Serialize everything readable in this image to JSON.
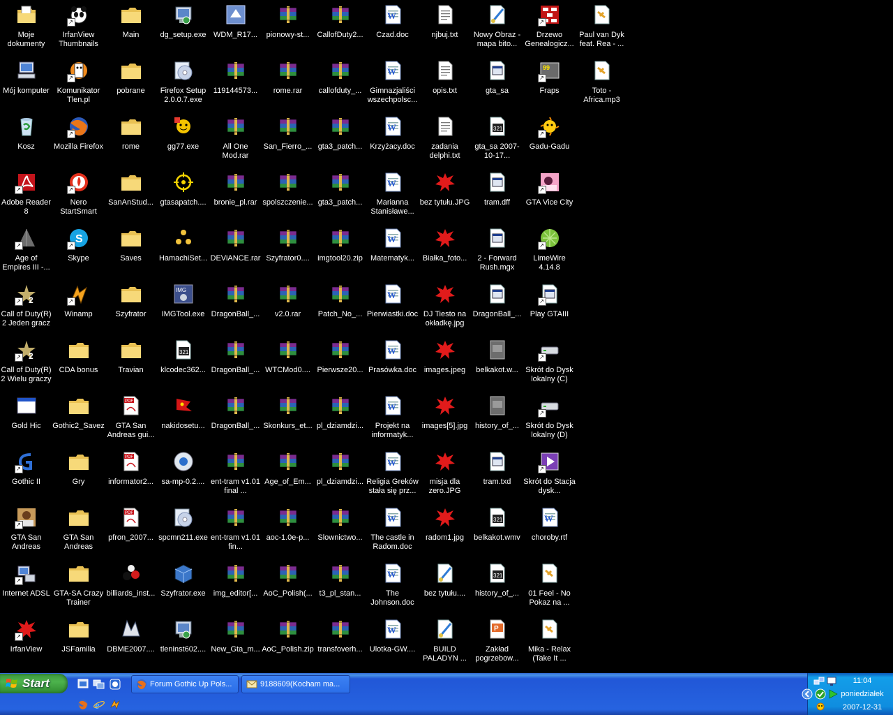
{
  "desktop": {
    "icons": [
      {
        "label": "Moje dokumenty",
        "type": "mydocs",
        "sc": false
      },
      {
        "label": "IrfanView Thumbnails",
        "type": "panda",
        "sc": true
      },
      {
        "label": "Main",
        "type": "folder",
        "sc": false
      },
      {
        "label": "dg_setup.exe",
        "type": "setup",
        "sc": false
      },
      {
        "label": "WDM_R17...",
        "type": "wdm",
        "sc": false
      },
      {
        "label": "pionowy-st...",
        "type": "rar",
        "sc": false
      },
      {
        "label": "CallofDuty2...",
        "type": "rar",
        "sc": false
      },
      {
        "label": "Czad.doc",
        "type": "doc",
        "sc": false
      },
      {
        "label": "njbuj.txt",
        "type": "txt",
        "sc": false
      },
      {
        "label": "Nowy Obraz - mapa bito...",
        "type": "paintfile",
        "sc": false
      },
      {
        "label": "Drzewo Genealogicz...",
        "type": "tree",
        "sc": true
      },
      {
        "label": "Paul van Dyk feat. Rea - ...",
        "type": "mp3",
        "sc": false
      },
      {
        "label": "Mój komputer",
        "type": "mycomp",
        "sc": false
      },
      {
        "label": "Komunikator Tlen.pl",
        "type": "tlen",
        "sc": true
      },
      {
        "label": "pobrane",
        "type": "folder",
        "sc": false
      },
      {
        "label": "Firefox Setup 2.0.0.7.exe",
        "type": "cdsetup",
        "sc": false
      },
      {
        "label": "119144573...",
        "type": "rar",
        "sc": false
      },
      {
        "label": "rome.rar",
        "type": "rar",
        "sc": false
      },
      {
        "label": "callofduty_...",
        "type": "rar",
        "sc": false
      },
      {
        "label": "Gimnazjaliści wszechpolsc...",
        "type": "doc",
        "sc": false
      },
      {
        "label": "opis.txt",
        "type": "txt",
        "sc": false
      },
      {
        "label": "gta_sa",
        "type": "dll",
        "sc": false
      },
      {
        "label": "Fraps",
        "type": "fraps",
        "sc": true
      },
      {
        "label": "Toto - Africa.mp3",
        "type": "mp3",
        "sc": false
      },
      {
        "label": "Kosz",
        "type": "bin",
        "sc": false
      },
      {
        "label": "Mozilla Firefox",
        "type": "firefox",
        "sc": true
      },
      {
        "label": "rome",
        "type": "folder",
        "sc": false
      },
      {
        "label": "gg77.exe",
        "type": "gg",
        "sc": false
      },
      {
        "label": "All One Mod.rar",
        "type": "rar",
        "sc": false
      },
      {
        "label": "San_Fierro_...",
        "type": "rar",
        "sc": false
      },
      {
        "label": "gta3_patch...",
        "type": "rar",
        "sc": false
      },
      {
        "label": "Krzyżacy.doc",
        "type": "doc",
        "sc": false
      },
      {
        "label": "zadania delphi.txt",
        "type": "txt",
        "sc": false
      },
      {
        "label": "gta_sa 2007-10-17...",
        "type": "video",
        "sc": false
      },
      {
        "label": "Gadu-Gadu",
        "type": "gadu",
        "sc": true
      },
      {
        "label": "Adobe Reader 8",
        "type": "adobe",
        "sc": true
      },
      {
        "label": "Nero StartSmart",
        "type": "nero",
        "sc": true
      },
      {
        "label": "SanAnStud...",
        "type": "folder",
        "sc": false
      },
      {
        "label": "gtasapatch....",
        "type": "target",
        "sc": false
      },
      {
        "label": "bronie_pl.rar",
        "type": "rar",
        "sc": false
      },
      {
        "label": "spolszczenie...",
        "type": "rar",
        "sc": false
      },
      {
        "label": "gta3_patch...",
        "type": "rar",
        "sc": false
      },
      {
        "label": "Marianna Stanisławe...",
        "type": "doc",
        "sc": false
      },
      {
        "label": "bez tytułu.JPG",
        "type": "splat",
        "sc": false
      },
      {
        "label": "tram.dff",
        "type": "dll",
        "sc": false
      },
      {
        "label": "GTA Vice City",
        "type": "vice",
        "sc": true
      },
      {
        "label": "Age of Empires III -...",
        "type": "aoe",
        "sc": true
      },
      {
        "label": "Skype",
        "type": "skype",
        "sc": true
      },
      {
        "label": "Saves",
        "type": "folder",
        "sc": false
      },
      {
        "label": "HamachiSet...",
        "type": "hamachi",
        "sc": false
      },
      {
        "label": "DEViANCE.rar",
        "type": "rar",
        "sc": false
      },
      {
        "label": "Szyfrator0....",
        "type": "rar",
        "sc": false
      },
      {
        "label": "imgtool20.zip",
        "type": "rar",
        "sc": false
      },
      {
        "label": "Matematyk...",
        "type": "doc",
        "sc": false
      },
      {
        "label": "Białka_foto...",
        "type": "splat",
        "sc": false
      },
      {
        "label": "2 - Forward Rush.mgx",
        "type": "dll",
        "sc": false
      },
      {
        "label": "LimeWire 4.14.8",
        "type": "lime",
        "sc": true
      },
      {
        "label": "Call of Duty(R) 2 Jeden gracz",
        "type": "cod",
        "sc": true
      },
      {
        "label": "Winamp",
        "type": "winamp",
        "sc": true
      },
      {
        "label": "Szyfrator",
        "type": "folder",
        "sc": false
      },
      {
        "label": "IMGTool.exe",
        "type": "imgtool",
        "sc": false
      },
      {
        "label": "DragonBall_...",
        "type": "rar",
        "sc": false
      },
      {
        "label": "v2.0.rar",
        "type": "rar",
        "sc": false
      },
      {
        "label": "Patch_No_...",
        "type": "rar",
        "sc": false
      },
      {
        "label": "Pierwiastki.doc",
        "type": "doc",
        "sc": false
      },
      {
        "label": "DJ Tiesto na okładkę.jpg",
        "type": "splat",
        "sc": false
      },
      {
        "label": "DragonBall_...",
        "type": "dll",
        "sc": false
      },
      {
        "label": "Play GTAIII",
        "type": "dll",
        "sc": true
      },
      {
        "label": "Call of Duty(R) 2 Wielu graczy",
        "type": "cod",
        "sc": true
      },
      {
        "label": "CDA bonus",
        "type": "folder",
        "sc": false
      },
      {
        "label": "Travian",
        "type": "folder",
        "sc": false
      },
      {
        "label": "klcodec362...",
        "type": "video",
        "sc": false
      },
      {
        "label": "DragonBall_...",
        "type": "rar",
        "sc": false
      },
      {
        "label": "WTCMod0....",
        "type": "rar",
        "sc": false
      },
      {
        "label": "Pierwsze20...",
        "type": "rar",
        "sc": false
      },
      {
        "label": "Prasówka.doc",
        "type": "doc",
        "sc": false
      },
      {
        "label": "images.jpeg",
        "type": "splat",
        "sc": false
      },
      {
        "label": "belkakot.w...",
        "type": "grayfile",
        "sc": false
      },
      {
        "label": "Skrót do Dysk lokalny (C)",
        "type": "drive",
        "sc": true
      },
      {
        "label": "Gold Hic",
        "type": "window",
        "sc": false
      },
      {
        "label": "Gothic2_Savez",
        "type": "folder",
        "sc": false
      },
      {
        "label": "GTA San Andreas gui...",
        "type": "pdf",
        "sc": false
      },
      {
        "label": "nakidosetu...",
        "type": "flag",
        "sc": false
      },
      {
        "label": "DragonBall_...",
        "type": "rar",
        "sc": false
      },
      {
        "label": "Skonkurs_et...",
        "type": "rar",
        "sc": false
      },
      {
        "label": "pl_dziamdzi...",
        "type": "rar",
        "sc": false
      },
      {
        "label": "Projekt na informatyk...",
        "type": "doc",
        "sc": false
      },
      {
        "label": "images[5].jpg",
        "type": "splat",
        "sc": false
      },
      {
        "label": "history_of_...",
        "type": "grayfile",
        "sc": false
      },
      {
        "label": "Skrót do Dysk lokalny (D)",
        "type": "drive",
        "sc": true
      },
      {
        "label": "Gothic II",
        "type": "gothic",
        "sc": true
      },
      {
        "label": "Gry",
        "type": "folder",
        "sc": false
      },
      {
        "label": "informator2...",
        "type": "pdf",
        "sc": false
      },
      {
        "label": "sa-mp-0.2....",
        "type": "samp",
        "sc": false
      },
      {
        "label": "ent-tram v1.01 final ...",
        "type": "rar",
        "sc": false
      },
      {
        "label": "Age_of_Em...",
        "type": "rar",
        "sc": false
      },
      {
        "label": "pl_dziamdzi...",
        "type": "rar",
        "sc": false
      },
      {
        "label": "Religia Greków stała się prz...",
        "type": "doc",
        "sc": false
      },
      {
        "label": "misja dla zero.JPG",
        "type": "splat",
        "sc": false
      },
      {
        "label": "tram.txd",
        "type": "dll",
        "sc": false
      },
      {
        "label": "Skrót do Stacja dysk...",
        "type": "purple",
        "sc": true
      },
      {
        "label": "GTA San Andreas",
        "type": "gtasa",
        "sc": true
      },
      {
        "label": "GTA San Andreas",
        "type": "folder",
        "sc": false
      },
      {
        "label": "pfron_2007...",
        "type": "pdf",
        "sc": false
      },
      {
        "label": "spcmn211.exe",
        "type": "cdsetup",
        "sc": false
      },
      {
        "label": "ent-tram v1.01 fin...",
        "type": "rar",
        "sc": false
      },
      {
        "label": "aoc-1.0e-p...",
        "type": "rar",
        "sc": false
      },
      {
        "label": "Slownictwo...",
        "type": "rar",
        "sc": false
      },
      {
        "label": "The castle in Radom.doc",
        "type": "doc",
        "sc": false
      },
      {
        "label": "radom1.jpg",
        "type": "splat",
        "sc": false
      },
      {
        "label": "belkakot.wmv",
        "type": "video",
        "sc": false
      },
      {
        "label": "choroby.rtf",
        "type": "doc",
        "sc": false
      },
      {
        "label": "Internet ADSL",
        "type": "netcomp",
        "sc": true
      },
      {
        "label": "GTA-SA Crazy Trainer",
        "type": "folder",
        "sc": false
      },
      {
        "label": "billiards_inst...",
        "type": "billiard",
        "sc": false
      },
      {
        "label": "Szyfrator.exe",
        "type": "box",
        "sc": false
      },
      {
        "label": "img_editor[...",
        "type": "rar",
        "sc": false
      },
      {
        "label": "AoC_Polish(...",
        "type": "rar",
        "sc": false
      },
      {
        "label": "t3_pl_stan...",
        "type": "rar",
        "sc": false
      },
      {
        "label": "The Johnson.doc",
        "type": "doc",
        "sc": false
      },
      {
        "label": "bez tytułu....",
        "type": "paintfile",
        "sc": false
      },
      {
        "label": "history_of_...",
        "type": "video",
        "sc": false
      },
      {
        "label": "01 Feel - No Pokaz na ...",
        "type": "mp3",
        "sc": false
      },
      {
        "label": "IrfanView",
        "type": "splat",
        "sc": true
      },
      {
        "label": "JSFamilia",
        "type": "folder",
        "sc": false
      },
      {
        "label": "DBME2007....",
        "type": "dbme",
        "sc": false
      },
      {
        "label": "tleninst602....",
        "type": "setup",
        "sc": false
      },
      {
        "label": "New_Gta_m...",
        "type": "rar",
        "sc": false
      },
      {
        "label": "AoC_Polish.zip",
        "type": "rar",
        "sc": false
      },
      {
        "label": "transfoverh...",
        "type": "rar",
        "sc": false
      },
      {
        "label": "Ulotka-GW....",
        "type": "doc",
        "sc": false
      },
      {
        "label": "BUILD PALADYN ...",
        "type": "paintfile",
        "sc": false
      },
      {
        "label": "Zakład pogrzebow...",
        "type": "ppt",
        "sc": false
      },
      {
        "label": "Mika - Relax (Take It ...",
        "type": "mp3",
        "sc": false
      }
    ]
  },
  "taskbar": {
    "start_label": "Start",
    "tasks": [
      {
        "label": "Forum Gothic Up Pols...",
        "icon": "firefox-icon"
      },
      {
        "label": "9188609(Kocham ma...",
        "icon": "mail-icon"
      }
    ],
    "clock": {
      "time": "11:04",
      "day": "poniedziałek",
      "date": "2007-12-31"
    }
  },
  "colors": {
    "desktop": "#000000",
    "taskbar": "#245edb",
    "start": "#3c9a3c",
    "tray": "#0f8ddf"
  }
}
